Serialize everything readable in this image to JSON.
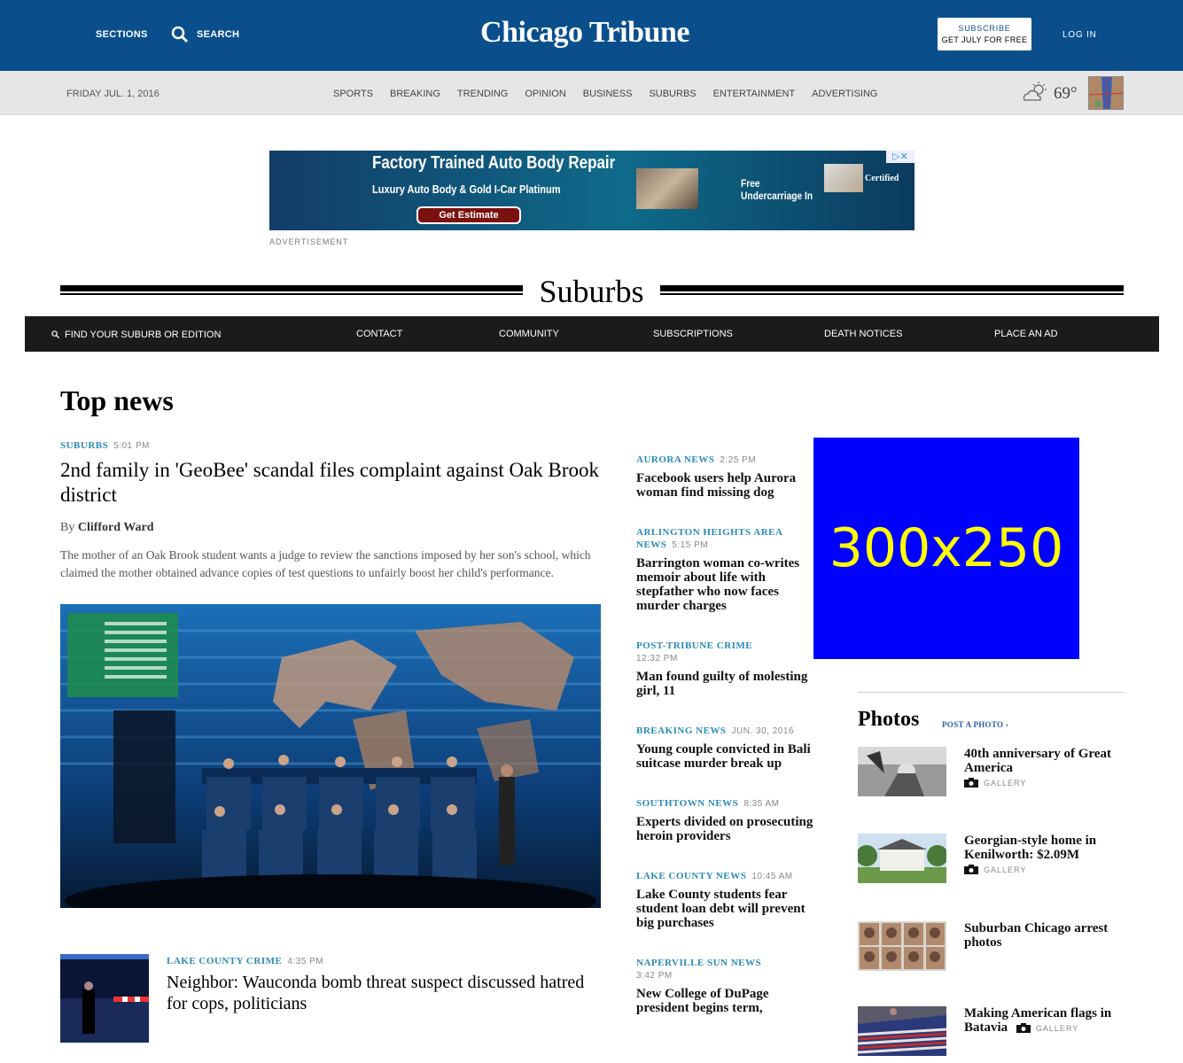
{
  "header": {
    "sections_label": "SECTIONS",
    "search_label": "SEARCH",
    "logo_text": "Chicago Tribune",
    "subscribe_line1": "SUBSCRIBE",
    "subscribe_line2": "GET JULY FOR FREE",
    "login_label": "LOG IN",
    "brand_color": "#0a4f8c"
  },
  "subnav": {
    "date": "FRIDAY JUL. 1, 2016",
    "links": [
      "SPORTS",
      "BREAKING",
      "TRENDING",
      "OPINION",
      "BUSINESS",
      "SUBURBS",
      "ENTERTAINMENT",
      "ADVERTISING"
    ],
    "weather_icon": "partly-cloudy-icon",
    "temperature": "69°"
  },
  "ad_banner": {
    "headline": "Factory Trained Auto Body Repair",
    "subline": "Luxury Auto Body & Gold I-Car Platinum",
    "cta": "Get Estimate",
    "offer": "Free\nUndercarriage In",
    "badge": "Certified",
    "label": "ADVERTISEMENT"
  },
  "section": {
    "title": "Suburbs"
  },
  "section_nav": {
    "find_label": "FIND YOUR SUBURB OR EDITION",
    "items": [
      "CONTACT",
      "COMMUNITY",
      "SUBSCRIPTIONS",
      "DEATH NOTICES",
      "PLACE AN AD"
    ]
  },
  "top_news": {
    "heading": "Top news",
    "lead": {
      "kicker": "SUBURBS",
      "time": "5:01 PM",
      "headline": "2nd family in 'GeoBee' scandal files complaint against Oak Brook district",
      "by": "By",
      "author": "Clifford Ward",
      "summary": "The mother of an Oak Brook student wants a judge to review the sanctions imposed by her son's school, which claimed the mother obtained advance copies of test questions to unfairly boost her child's performance."
    },
    "second": {
      "kicker": "LAKE COUNTY CRIME",
      "time": "4:35 PM",
      "headline": "Neighbor: Wauconda bomb threat suspect discussed hatred for cops, politicians"
    }
  },
  "mid_stories": [
    {
      "kicker": "AURORA NEWS",
      "time": "2:25 PM",
      "headline": "Facebook users help Aurora woman find missing dog"
    },
    {
      "kicker": "ARLINGTON HEIGHTS AREA NEWS",
      "time": "5:15 PM",
      "headline": "Barrington woman co-writes memoir about life with stepfather who now faces murder charges"
    },
    {
      "kicker": "POST-TRIBUNE CRIME",
      "time": "12:32 PM",
      "headline": "Man found guilty of molesting girl, 11"
    },
    {
      "kicker": "BREAKING NEWS",
      "time": "JUN. 30, 2016",
      "headline": "Young couple convicted in Bali suitcase murder break up"
    },
    {
      "kicker": "SOUTHTOWN NEWS",
      "time": "8:35 AM",
      "headline": "Experts divided on prosecuting heroin providers"
    },
    {
      "kicker": "LAKE COUNTY NEWS",
      "time": "10:45 AM",
      "headline": "Lake County students fear student loan debt will prevent big purchases"
    },
    {
      "kicker": "NAPERVILLE SUN NEWS",
      "time": "3:42 PM",
      "headline": "New College of DuPage president begins term,"
    }
  ],
  "right_ad": {
    "text": "300x250",
    "bg_color": "#0000ff",
    "fg_color": "#ffff00"
  },
  "photos": {
    "title": "Photos",
    "post_link": "POST A PHOTO ›",
    "gallery_label": "GALLERY",
    "items": [
      {
        "title": "40th anniversary of Great America",
        "gallery": true
      },
      {
        "title": "Georgian-style home in Kenilworth: $2.09M",
        "gallery": true
      },
      {
        "title": "Suburban Chicago arrest photos",
        "gallery": false
      },
      {
        "title": "Making American flags in Batavia",
        "gallery": true
      }
    ]
  }
}
